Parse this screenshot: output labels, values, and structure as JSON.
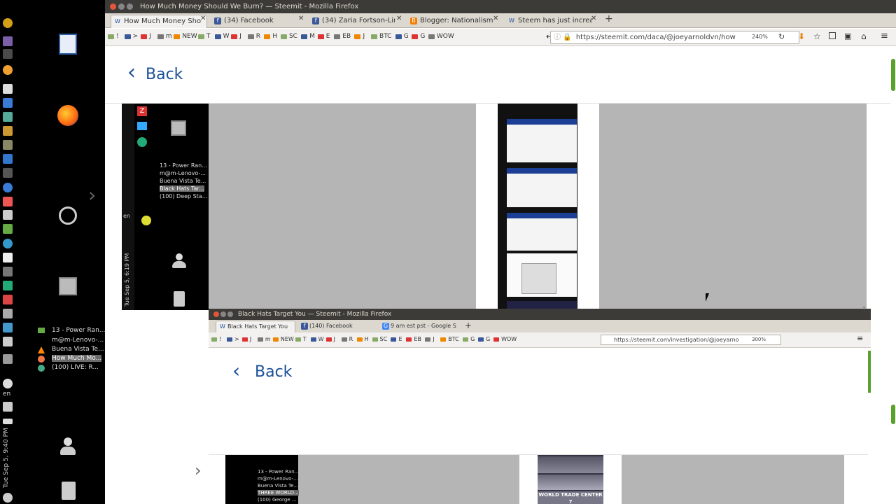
{
  "window": {
    "title": "How Much Money Should We Burn? — Steemit - Mozilla Firefox",
    "tabs": [
      {
        "label": "How Much Money Sho",
        "active": true
      },
      {
        "label": "(34) Facebook",
        "active": false
      },
      {
        "label": "(34) Zaria Fortson-Lin",
        "active": false
      },
      {
        "label": "Blogger: Nationalism",
        "active": false
      },
      {
        "label": "Steem has just increa",
        "active": false
      }
    ],
    "new_tab": "+",
    "bookmarks": [
      "!",
      ">",
      "J",
      "m",
      "NEW",
      "T",
      "W",
      "J",
      "R",
      "H",
      "SC",
      "M",
      "E",
      "EB",
      "J",
      "BTC",
      "G",
      "G",
      "WOW"
    ],
    "url": "https://steemit.com/daca/@joeyarnoldvn/how",
    "zoom": "240%",
    "back_label": "Back"
  },
  "desktop": {
    "clock": "Tue Sep 5, 9:40 PM",
    "lang": "en",
    "tasks": [
      {
        "label": "13 - Power Ran...",
        "selected": false
      },
      {
        "label": "m@m-Lenovo-...",
        "selected": false
      },
      {
        "label": "Buena Vista Te...",
        "selected": false
      },
      {
        "label": "How Much Mo...",
        "selected": true
      },
      {
        "label": "(100) LIVE: R...",
        "selected": false
      }
    ]
  },
  "nested1": {
    "clock": "Tue Sep 5, 6:19 PM",
    "lang": "en",
    "tasks": [
      {
        "label": "13 - Power Ran...",
        "selected": false
      },
      {
        "label": "m@m-Lenovo-...",
        "selected": false
      },
      {
        "label": "Buena Vista Te...",
        "selected": false
      },
      {
        "label": "Black Hats Tar...",
        "selected": true
      },
      {
        "label": "(100) Deep Sta...",
        "selected": false
      }
    ]
  },
  "nested_window": {
    "title": "Black Hats Target You — Steemit - Mozilla Firefox",
    "tabs": [
      {
        "label": "Black Hats Target You",
        "active": true
      },
      {
        "label": "(140) Facebook",
        "active": false
      },
      {
        "label": "9 am est pst - Google S",
        "active": false
      }
    ],
    "new_tab": "+",
    "bookmarks": [
      "!",
      ">",
      "J",
      "m",
      "NEW",
      "T",
      "W",
      "J",
      "R",
      "H",
      "SC",
      "E",
      "EB",
      "J",
      "BTC",
      "G",
      "G",
      "WOW"
    ],
    "url": "https://steemit.com/investigation/@joeyarno",
    "zoom": "300%",
    "back_label": "Back",
    "tasks": [
      {
        "label": "13 - Power Ran...",
        "selected": false
      },
      {
        "label": "m@m-Lenovo-...",
        "selected": false
      },
      {
        "label": "Buena Vista Te...",
        "selected": false
      },
      {
        "label": "THREE WORLD...",
        "selected": true
      },
      {
        "label": "(100) George ...",
        "selected": false
      }
    ],
    "image_caption": "WORLD TRADE CENTER 7"
  },
  "colors": {
    "accent": "#1a5099",
    "titlebar": "#3c3b37",
    "tab_bg": "#dcd8d0",
    "scroll_green": "#5aa02c"
  }
}
